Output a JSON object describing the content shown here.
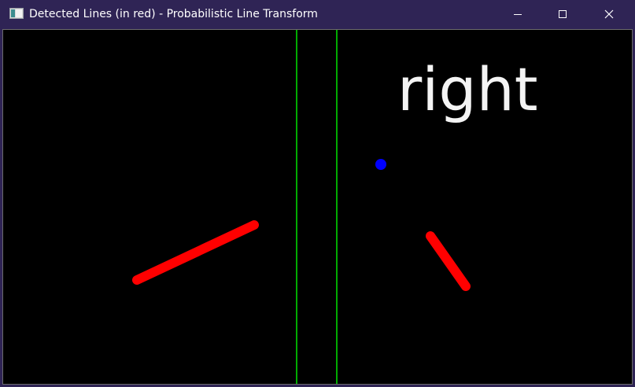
{
  "window": {
    "title": "Detected Lines (in red) - Probabilistic Line Transform",
    "icon": "opencv-window-icon",
    "controls": {
      "minimize": "minimize-icon",
      "maximize": "maximize-icon",
      "close": "close-icon"
    }
  },
  "image": {
    "text": "right",
    "colors": {
      "background": "#000000",
      "detected_lines": "#ff0000",
      "vertical_lines": "#00aa00",
      "point": "#0000ff",
      "text": "#f4f4f4"
    }
  }
}
